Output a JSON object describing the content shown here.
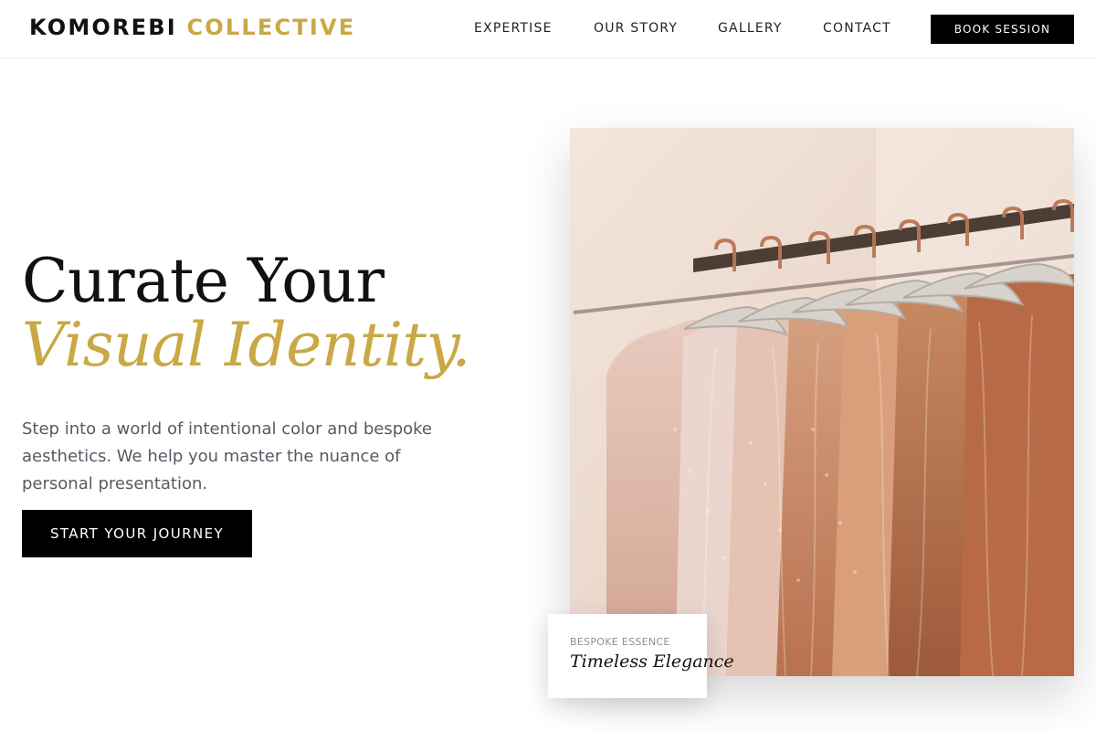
{
  "header": {
    "brand_primary": "KOMOREBI",
    "brand_accent": "COLLECTIVE",
    "nav": [
      "EXPERTISE",
      "OUR STORY",
      "GALLERY",
      "CONTACT"
    ],
    "book_label": "BOOK SESSION"
  },
  "hero": {
    "title_line1": "Curate Your",
    "title_line2": "Visual Identity.",
    "description": "Step into a world of intentional color and bespoke aesthetics. We help you master the nuance of personal presentation.",
    "cta_label": "START YOUR JOURNEY"
  },
  "feature_card": {
    "label": "BESPOKE ESSENCE",
    "title": "Timeless Elegance"
  },
  "theme": {
    "accent": "#c9a845",
    "button_bg": "#000000"
  }
}
